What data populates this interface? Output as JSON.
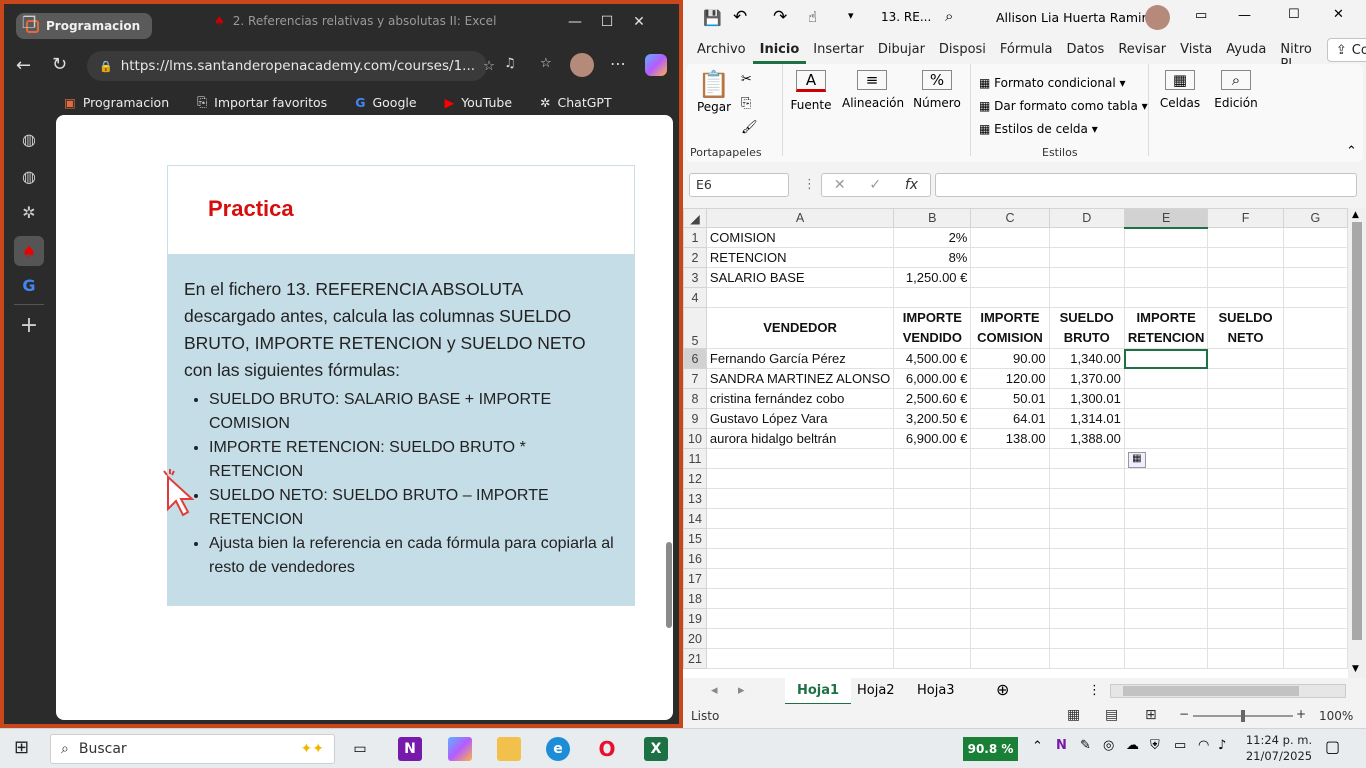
{
  "browser": {
    "tab_group": "Programacion",
    "tab_title": "2. Referencias relativas y absolutas II: Excel",
    "url": "https://lms.santanderopenacademy.com/courses/1...",
    "bookmarks": [
      "Programacion",
      "Importar favoritos",
      "Google",
      "YouTube",
      "ChatGPT"
    ]
  },
  "lesson": {
    "heading": "Practica",
    "intro": "En el fichero 13. REFERENCIA ABSOLUTA descargado antes, calcula las columnas SUELDO BRUTO, IMPORTE RETENCION y SUELDO NETO con las siguientes fórmulas:",
    "bullets": [
      "SUELDO BRUTO: SALARIO BASE + IMPORTE COMISION",
      "IMPORTE RETENCION: SUELDO BRUTO * RETENCION",
      "SUELDO NETO: SUELDO BRUTO – IMPORTE RETENCION",
      "Ajusta bien la referencia en cada fórmula para copiarla al resto de vendedores"
    ]
  },
  "excel": {
    "file_title": "13. RE...",
    "user": "Allison Lia Huerta Ramirez",
    "ribbon_tabs": [
      "Archivo",
      "Inicio",
      "Insertar",
      "Dibujar",
      "Disposi",
      "Fórmula",
      "Datos",
      "Revisar",
      "Vista",
      "Ayuda",
      "Nitro PI"
    ],
    "share": "Compartir",
    "groups": {
      "pegar": "Pegar",
      "portapapeles": "Portapapeles",
      "fuente": "Fuente",
      "alineacion": "Alineación",
      "numero": "Número",
      "formato_condicional": "Formato condicional",
      "dar_formato": "Dar formato como tabla",
      "estilos_celda": "Estilos de celda",
      "estilos": "Estilos",
      "celdas": "Celdas",
      "edicion": "Edición"
    },
    "name_box": "E6",
    "columns": [
      "A",
      "B",
      "C",
      "D",
      "E",
      "F",
      "G"
    ],
    "rows": {
      "r1": {
        "a": "COMISION",
        "b": "2%"
      },
      "r2": {
        "a": "RETENCION",
        "b": "8%"
      },
      "r3": {
        "a": "SALARIO BASE",
        "b": "1,250.00 €"
      },
      "headers": {
        "a": "VENDEDOR",
        "b1": "IMPORTE",
        "b2": "VENDIDO",
        "c1": "IMPORTE",
        "c2": "COMISION",
        "d1": "SUELDO",
        "d2": "BRUTO",
        "e1": "IMPORTE",
        "e2": "RETENCION",
        "f1": "SUELDO",
        "f2": "NETO"
      },
      "data": [
        {
          "name": "Fernando García Pérez",
          "vendido": "4,500.00 €",
          "comision": "90.00",
          "bruto": "1,340.00"
        },
        {
          "name": "SANDRA MARTINEZ ALONSO",
          "vendido": "6,000.00 €",
          "comision": "120.00",
          "bruto": "1,370.00"
        },
        {
          "name": "cristina fernández cobo",
          "vendido": "2,500.60 €",
          "comision": "50.01",
          "bruto": "1,300.01"
        },
        {
          "name": "Gustavo López Vara",
          "vendido": "3,200.50 €",
          "comision": "64.01",
          "bruto": "1,314.01"
        },
        {
          "name": "aurora hidalgo beltrán",
          "vendido": "6,900.00 €",
          "comision": "138.00",
          "bruto": "1,388.00"
        }
      ]
    },
    "row_numbers": [
      "1",
      "2",
      "3",
      "4",
      "5",
      "6",
      "7",
      "8",
      "9",
      "10",
      "11",
      "12",
      "13",
      "14",
      "15",
      "16",
      "17",
      "18",
      "19",
      "20",
      "21"
    ],
    "sheets": [
      "Hoja1",
      "Hoja2",
      "Hoja3"
    ],
    "status": "Listo",
    "zoom": "100%"
  },
  "taskbar": {
    "search": "Buscar",
    "battery": "90.8 %",
    "time": "11:24 p. m.",
    "date": "21/07/2025"
  },
  "colors": {
    "accent_red": "#d70e0e",
    "excel_green": "#1e7145",
    "frame": "#c8471b"
  }
}
